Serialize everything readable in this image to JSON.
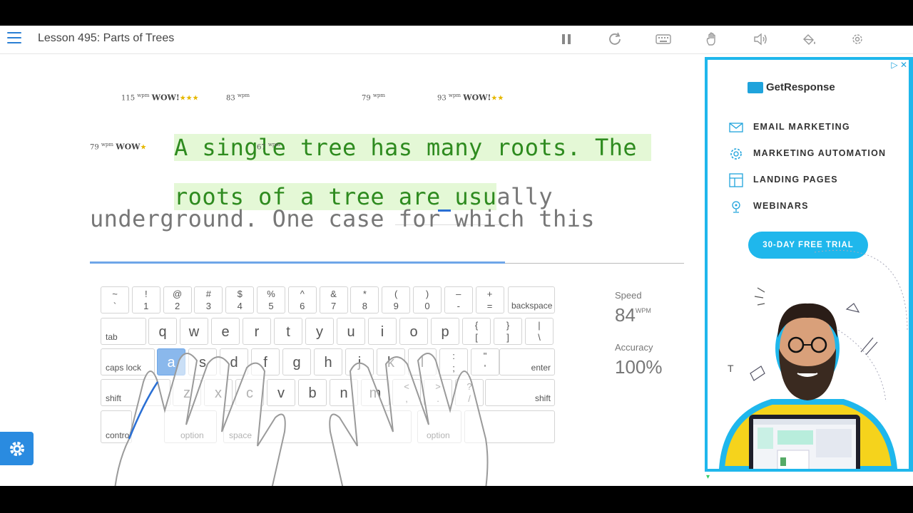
{
  "header": {
    "title": "Lesson 495: Parts of Trees"
  },
  "toolbar": {
    "icons": [
      "pause-icon",
      "restart-icon",
      "keyboard-icon",
      "hand-icon",
      "sound-icon",
      "theme-icon",
      "gear-icon"
    ]
  },
  "typing": {
    "line1": [
      {
        "text": "A",
        "state": "done"
      },
      {
        "text": " ",
        "state": "space"
      },
      {
        "text": "single",
        "state": "done"
      },
      {
        "text": " ",
        "state": "space"
      },
      {
        "text": "tree",
        "state": "done"
      },
      {
        "text": " ",
        "state": "space"
      },
      {
        "text": "has",
        "state": "done"
      },
      {
        "text": " ",
        "state": "space"
      },
      {
        "text": "many",
        "state": "done"
      },
      {
        "text": " ",
        "state": "space"
      },
      {
        "text": "roots.",
        "state": "done"
      },
      {
        "text": " ",
        "state": "space"
      },
      {
        "text": "The",
        "state": "done"
      }
    ],
    "line2_done": [
      "roots",
      "of",
      "a",
      "tree",
      "are"
    ],
    "line2_current_typed": "usu",
    "line2_current_rest": "ally",
    "line3": "underground. One case for which this",
    "badges": [
      {
        "wpm": "115",
        "unit": "wpm",
        "label": "WOW!",
        "stars": "★★★"
      },
      {
        "wpm": "83",
        "unit": "wpm",
        "label": "",
        "stars": ""
      },
      {
        "wpm": "79",
        "unit": "wpm",
        "label": "",
        "stars": ""
      },
      {
        "wpm": "93",
        "unit": "wpm",
        "label": "WOW!",
        "stars": "★★"
      },
      {
        "wpm": "79",
        "unit": "wpm",
        "label": "WOW",
        "stars": "★"
      },
      {
        "wpm": "67",
        "unit": "wpm",
        "label": "",
        "stars": ""
      }
    ]
  },
  "keyboard": {
    "row1": [
      {
        "top": "~",
        "bottom": "`"
      },
      {
        "top": "!",
        "bottom": "1"
      },
      {
        "top": "@",
        "bottom": "2"
      },
      {
        "top": "#",
        "bottom": "3"
      },
      {
        "top": "$",
        "bottom": "4"
      },
      {
        "top": "%",
        "bottom": "5"
      },
      {
        "top": "^",
        "bottom": "6"
      },
      {
        "top": "&",
        "bottom": "7"
      },
      {
        "top": "*",
        "bottom": "8"
      },
      {
        "top": "(",
        "bottom": "9"
      },
      {
        "top": ")",
        "bottom": "0"
      },
      {
        "top": "–",
        "bottom": "-"
      },
      {
        "top": "+",
        "bottom": "="
      }
    ],
    "backspace": "backspace",
    "tab": "tab",
    "row2": [
      "q",
      "w",
      "e",
      "r",
      "t",
      "y",
      "u",
      "i",
      "o",
      "p"
    ],
    "row2_sym": [
      {
        "top": "{",
        "bottom": "["
      },
      {
        "top": "}",
        "bottom": "]"
      },
      {
        "top": "|",
        "bottom": "\\"
      }
    ],
    "caps": "caps lock",
    "row3": [
      "a",
      "s",
      "d",
      "f",
      "g",
      "h",
      "j",
      "k",
      "l"
    ],
    "row3_sym": [
      {
        "top": ":",
        "bottom": ";"
      },
      {
        "top": "\"",
        "bottom": "'"
      }
    ],
    "enter": "enter",
    "shift": "shift",
    "row4": [
      "z",
      "x",
      "c",
      "v",
      "b",
      "n",
      "m"
    ],
    "row4_sym": [
      {
        "top": "<",
        "bottom": ","
      },
      {
        "top": ">",
        "bottom": "."
      },
      {
        "top": "?",
        "bottom": "/"
      }
    ],
    "control": "control",
    "option": "option",
    "space": "space",
    "highlighted": "a"
  },
  "stats": {
    "speed_label": "Speed",
    "speed_value": "84",
    "speed_unit": "WPM",
    "accuracy_label": "Accuracy",
    "accuracy_value": "100%"
  },
  "ad": {
    "adchoices": "▷ ✕",
    "brand": "GetResponse",
    "items": [
      "EMAIL MARKETING",
      "MARKETING AUTOMATION",
      "LANDING PAGES",
      "WEBINARS"
    ],
    "cta": "30-DAY FREE TRIAL"
  }
}
